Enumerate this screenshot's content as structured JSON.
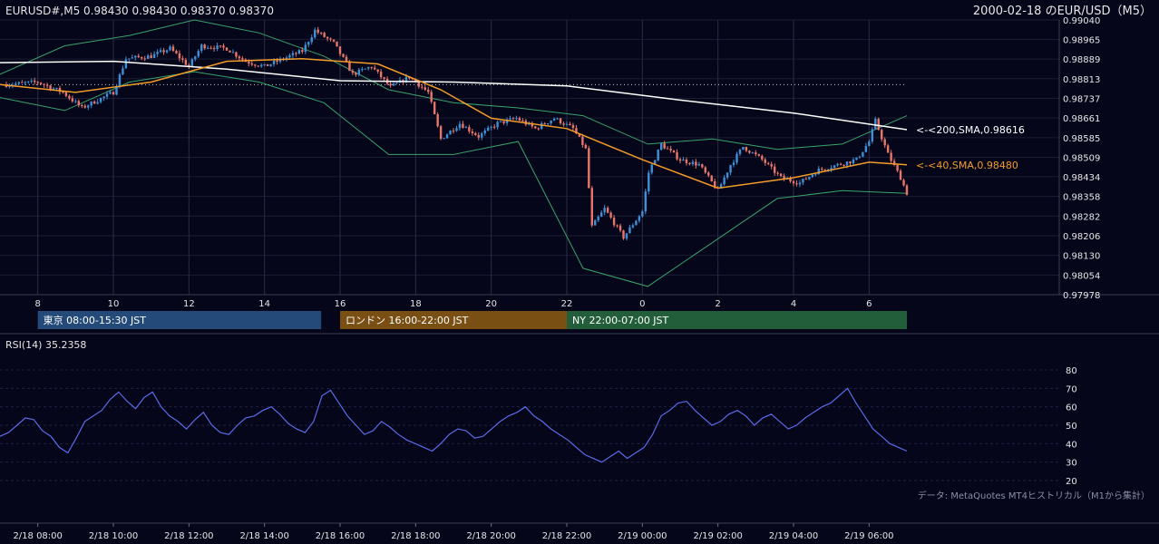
{
  "header": {
    "symbol_ohlc": "EURUSD#,M5 0.98430 0.98430 0.98370 0.98370",
    "date_symbol": "2000-02-18 のEUR/USD（M5）"
  },
  "chart_data": [
    {
      "type": "candlestick",
      "timeframe": "M5",
      "ylim": [
        0.97978,
        0.9904
      ],
      "y_ticks": [
        "0.99040",
        "0.98965",
        "0.98889",
        "0.98813",
        "0.98737",
        "0.98661",
        "0.98585",
        "0.98509",
        "0.98434",
        "0.98358",
        "0.98282",
        "0.98206",
        "0.98130",
        "0.98054",
        "0.97978"
      ],
      "x_hour_ticks": [
        "8",
        "10",
        "12",
        "14",
        "16",
        "18",
        "20",
        "22",
        "0",
        "2",
        "4",
        "6"
      ],
      "reference_line": 0.9879,
      "close_points": [
        {
          "t": "2/18 07:10",
          "v": 0.9879
        },
        {
          "t": "2/18 08:00",
          "v": 0.988
        },
        {
          "t": "2/18 08:40",
          "v": 0.9876
        },
        {
          "t": "2/18 09:10",
          "v": 0.987
        },
        {
          "t": "2/18 10:00",
          "v": 0.9876
        },
        {
          "t": "2/18 10:20",
          "v": 0.9889
        },
        {
          "t": "2/18 11:00",
          "v": 0.989
        },
        {
          "t": "2/18 11:30",
          "v": 0.9893
        },
        {
          "t": "2/18 12:00",
          "v": 0.9886
        },
        {
          "t": "2/18 12:20",
          "v": 0.9894
        },
        {
          "t": "2/18 13:00",
          "v": 0.9893
        },
        {
          "t": "2/18 13:30",
          "v": 0.9888
        },
        {
          "t": "2/18 14:00",
          "v": 0.9886
        },
        {
          "t": "2/18 14:30",
          "v": 0.9889
        },
        {
          "t": "2/18 15:00",
          "v": 0.9892
        },
        {
          "t": "2/18 15:20",
          "v": 0.99
        },
        {
          "t": "2/18 15:50",
          "v": 0.9895
        },
        {
          "t": "2/18 16:20",
          "v": 0.9883
        },
        {
          "t": "2/18 16:50",
          "v": 0.9886
        },
        {
          "t": "2/18 17:20",
          "v": 0.9878
        },
        {
          "t": "2/18 17:50",
          "v": 0.9882
        },
        {
          "t": "2/18 18:20",
          "v": 0.9876
        },
        {
          "t": "2/18 18:40",
          "v": 0.9858
        },
        {
          "t": "2/18 19:10",
          "v": 0.9864
        },
        {
          "t": "2/18 19:40",
          "v": 0.9859
        },
        {
          "t": "2/18 20:10",
          "v": 0.9864
        },
        {
          "t": "2/18 20:40",
          "v": 0.9866
        },
        {
          "t": "2/18 21:10",
          "v": 0.9862
        },
        {
          "t": "2/18 21:40",
          "v": 0.9866
        },
        {
          "t": "2/18 22:10",
          "v": 0.9862
        },
        {
          "t": "2/18 22:30",
          "v": 0.9854
        },
        {
          "t": "2/18 22:40",
          "v": 0.9824
        },
        {
          "t": "2/18 23:00",
          "v": 0.9831
        },
        {
          "t": "2/18 23:30",
          "v": 0.982
        },
        {
          "t": "2/19 00:00",
          "v": 0.983
        },
        {
          "t": "2/19 00:10",
          "v": 0.9845
        },
        {
          "t": "2/19 00:30",
          "v": 0.9856
        },
        {
          "t": "2/19 01:00",
          "v": 0.985
        },
        {
          "t": "2/19 01:30",
          "v": 0.9848
        },
        {
          "t": "2/19 02:00",
          "v": 0.9838
        },
        {
          "t": "2/19 02:20",
          "v": 0.9848
        },
        {
          "t": "2/19 02:40",
          "v": 0.9855
        },
        {
          "t": "2/19 03:10",
          "v": 0.985
        },
        {
          "t": "2/19 03:40",
          "v": 0.9843
        },
        {
          "t": "2/19 04:10",
          "v": 0.9841
        },
        {
          "t": "2/19 04:40",
          "v": 0.9846
        },
        {
          "t": "2/19 05:10",
          "v": 0.9848
        },
        {
          "t": "2/19 05:40",
          "v": 0.985
        },
        {
          "t": "2/19 06:00",
          "v": 0.9857
        },
        {
          "t": "2/19 06:10",
          "v": 0.9865
        },
        {
          "t": "2/19 06:30",
          "v": 0.9852
        },
        {
          "t": "2/19 06:50",
          "v": 0.9843
        },
        {
          "t": "2/19 07:00",
          "v": 0.9837
        }
      ],
      "sma200": {
        "label": "<200,SMA,0.98616",
        "value": 0.98616,
        "color": "#ffffff",
        "points": [
          {
            "t": "2/18 07:00",
            "v": 0.98875
          },
          {
            "t": "2/18 10:00",
            "v": 0.9888
          },
          {
            "t": "2/18 13:00",
            "v": 0.9885
          },
          {
            "t": "2/18 16:00",
            "v": 0.98805
          },
          {
            "t": "2/18 19:00",
            "v": 0.988
          },
          {
            "t": "2/18 22:00",
            "v": 0.98785
          },
          {
            "t": "2/19 01:00",
            "v": 0.9873
          },
          {
            "t": "2/19 04:00",
            "v": 0.9868
          },
          {
            "t": "2/19 07:00",
            "v": 0.98616
          }
        ]
      },
      "sma40": {
        "label": "<40,SMA,0.98480",
        "value": 0.9848,
        "color": "#f39c2a",
        "points": [
          {
            "t": "2/18 07:00",
            "v": 0.9879
          },
          {
            "t": "2/18 09:00",
            "v": 0.9876
          },
          {
            "t": "2/18 11:00",
            "v": 0.988
          },
          {
            "t": "2/18 13:00",
            "v": 0.9888
          },
          {
            "t": "2/18 15:00",
            "v": 0.9889
          },
          {
            "t": "2/18 17:00",
            "v": 0.9887
          },
          {
            "t": "2/18 18:40",
            "v": 0.9877
          },
          {
            "t": "2/18 20:00",
            "v": 0.9866
          },
          {
            "t": "2/18 22:00",
            "v": 0.9862
          },
          {
            "t": "2/19 00:00",
            "v": 0.985
          },
          {
            "t": "2/19 02:00",
            "v": 0.9839
          },
          {
            "t": "2/19 04:00",
            "v": 0.9843
          },
          {
            "t": "2/19 06:00",
            "v": 0.9849
          },
          {
            "t": "2/19 07:00",
            "v": 0.9848
          }
        ]
      },
      "bollinger_upper": [
        0.9883,
        0.9894,
        0.9898,
        0.9904,
        0.9899,
        0.989,
        0.9877,
        0.9872,
        0.987,
        0.9867,
        0.9856,
        0.9858,
        0.9854,
        0.9856,
        0.9867
      ],
      "bollinger_lower": [
        0.9874,
        0.9869,
        0.988,
        0.9884,
        0.988,
        0.9872,
        0.9852,
        0.9852,
        0.9857,
        0.9808,
        0.9801,
        0.9818,
        0.9835,
        0.9838,
        0.9837
      ],
      "sessions": [
        {
          "label": "東京 08:00-15:30 JST",
          "color": "#234a78"
        },
        {
          "label": "ロンドン 16:00-22:00 JST",
          "color": "#7a4f14"
        },
        {
          "label": "NY 22:00-07:00 JST",
          "color": "#235e3a"
        }
      ]
    },
    {
      "type": "line",
      "title": "RSI(14) 35.2358",
      "ylim": [
        20,
        80
      ],
      "y_ticks": [
        "80",
        "70",
        "60",
        "50",
        "40",
        "30",
        "20"
      ],
      "line_color": "#5a6be8",
      "values": [
        44,
        46,
        50,
        54,
        53,
        47,
        44,
        38,
        35,
        43,
        52,
        55,
        58,
        64,
        68,
        63,
        59,
        65,
        68,
        60,
        55,
        52,
        48,
        53,
        57,
        50,
        46,
        45,
        50,
        54,
        55,
        58,
        60,
        56,
        51,
        48,
        46,
        52,
        66,
        69,
        62,
        55,
        50,
        45,
        47,
        52,
        49,
        45,
        42,
        40,
        38,
        36,
        40,
        45,
        48,
        47,
        43,
        44,
        48,
        52,
        55,
        57,
        60,
        55,
        52,
        48,
        45,
        42,
        38,
        34,
        32,
        30,
        33,
        36,
        32,
        35,
        38,
        45,
        55,
        58,
        62,
        63,
        58,
        54,
        50,
        52,
        56,
        58,
        55,
        50,
        54,
        56,
        52,
        48,
        50,
        54,
        57,
        60,
        62,
        66,
        70,
        62,
        55,
        48,
        44,
        40,
        38,
        36
      ],
      "x_labels": [
        "2/18 08:00",
        "2/18 10:00",
        "2/18 12:00",
        "2/18 14:00",
        "2/18 16:00",
        "2/18 18:00",
        "2/18 20:00",
        "2/18 22:00",
        "2/19 00:00",
        "2/19 02:00",
        "2/19 04:00",
        "2/19 06:00"
      ],
      "note": "データ: MetaQuotes MT4ヒストリカル（M1から集計）"
    }
  ]
}
